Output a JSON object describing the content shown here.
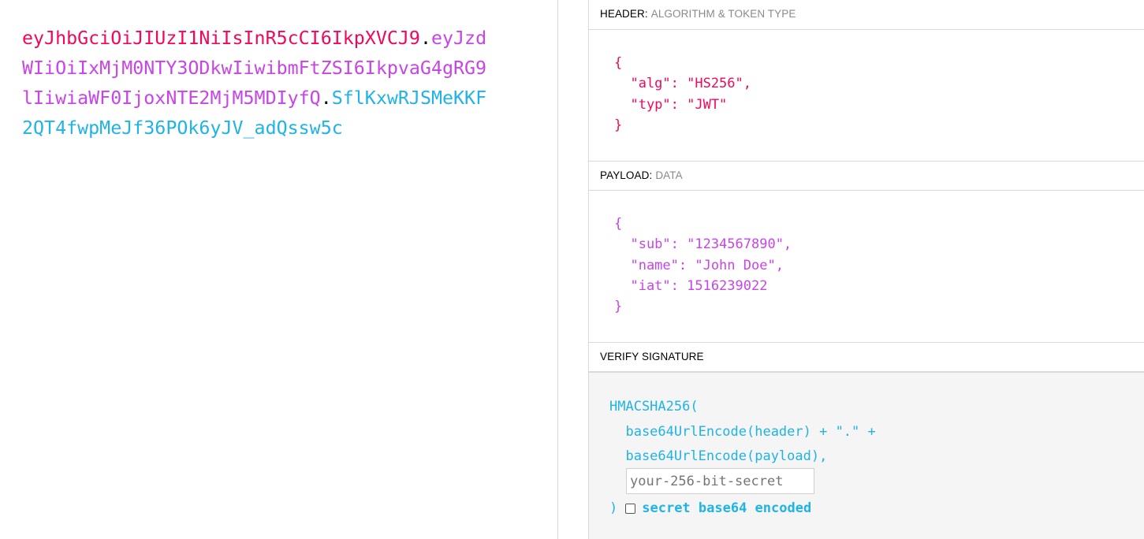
{
  "encoded": {
    "header": "eyJhbGciOiJIUzI1NiIsInR5cCI6IkpXVCJ9",
    "payload": "eyJzdWIiOiIxMjM0NTY3ODkwIiwibmFtZSI6IkpvaG4gRG9lIiwiaWF0IjoxNTE2MjM5MDIyfQ",
    "signature": "SflKxwRJSMeKKF2QT4fwpMeJf36POk6yJV_adQssw5c",
    "dot": "."
  },
  "header_section": {
    "title": "HEADER:",
    "subtitle": "ALGORITHM & TOKEN TYPE",
    "json_text": "{\n  \"alg\": \"HS256\",\n  \"typ\": \"JWT\"\n}"
  },
  "payload_section": {
    "title": "PAYLOAD:",
    "subtitle": "DATA",
    "json_text": "{\n  \"sub\": \"1234567890\",\n  \"name\": \"John Doe\",\n  \"iat\": 1516239022\n}"
  },
  "signature_section": {
    "title": "VERIFY SIGNATURE",
    "code_text": "HMACSHA256(\n  base64UrlEncode(header) + \".\" +\n  base64UrlEncode(payload),",
    "secret_placeholder": "your-256-bit-secret",
    "close_paren": ")",
    "checkbox_label": "secret base64 encoded"
  },
  "colors": {
    "header": "#f2075c",
    "payload": "#c844e8",
    "signature": "#1fb3e6"
  }
}
